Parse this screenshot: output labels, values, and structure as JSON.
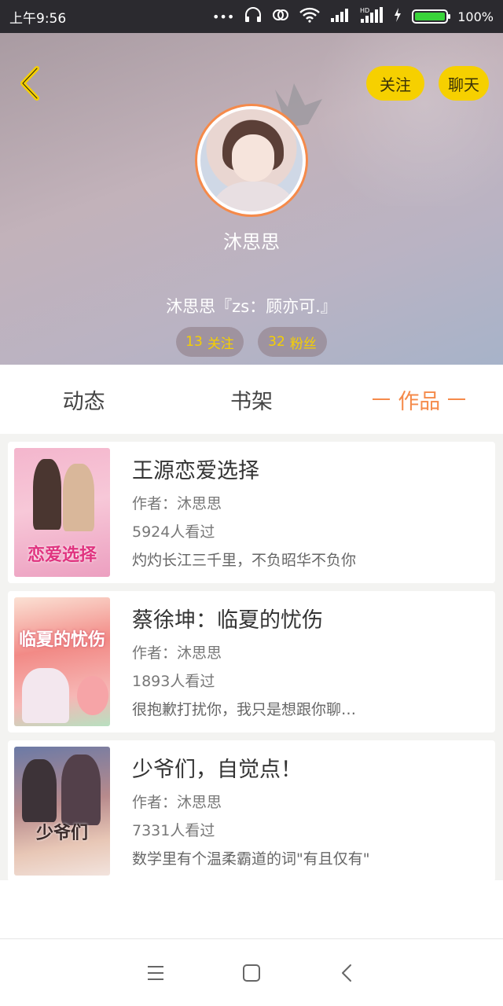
{
  "status_bar": {
    "time": "上午9:56",
    "battery_percent": "100%",
    "battery_level": 1.0,
    "icons": [
      "more-dots-icon",
      "headset-icon",
      "sync-icon",
      "wifi-icon",
      "signal-icon",
      "hd-signal-icon",
      "charging-icon",
      "battery-icon"
    ]
  },
  "header": {
    "follow_label": "关注",
    "chat_label": "聊天",
    "username": "沐思思",
    "bio": "沐思思『zs：顾亦可.』",
    "following_count": "13",
    "following_label": "关注",
    "fans_count": "32",
    "fans_label": "粉丝",
    "accent_color": "#f6d000",
    "avatar_ring_color": "#f58a4a"
  },
  "tabs": [
    {
      "label": "动态",
      "active": false
    },
    {
      "label": "书架",
      "active": false
    },
    {
      "label": "作品",
      "active": true
    }
  ],
  "books": [
    {
      "title": "王源恋爱选择",
      "author": "作者：沐思思",
      "views": "5924人看过",
      "desc": "灼灼长江三千里，不负昭华不负你",
      "cover_text": "恋爱选择"
    },
    {
      "title": "蔡徐坤：临夏的忧伤",
      "author": "作者：沐思思",
      "views": "1893人看过",
      "desc": "很抱歉打扰你，我只是想跟你聊…",
      "cover_text": "临夏的忧伤"
    },
    {
      "title": "少爷们，自觉点！",
      "author": "作者：沐思思",
      "views": "7331人看过",
      "desc": "数学里有个温柔霸道的词\"有且仅有\"",
      "cover_text": "少爷们"
    }
  ],
  "nav_bar": {
    "icons": [
      "menu-icon",
      "home-square-icon",
      "back-arrow-icon"
    ]
  }
}
